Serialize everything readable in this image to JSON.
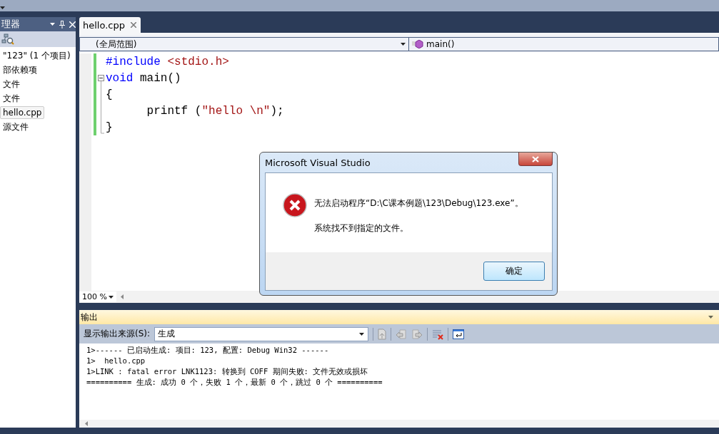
{
  "explorer": {
    "title": "理器",
    "tree": [
      {
        "label": "\"123\" (1 个项目)",
        "selected": false,
        "children": [
          {
            "label": "部依赖项",
            "selected": false
          },
          {
            "label": "文件",
            "selected": false
          },
          {
            "label": "文件",
            "selected": false,
            "children": [
              {
                "label": "hello.cpp",
                "selected": true
              }
            ]
          },
          {
            "label": "源文件",
            "selected": false
          }
        ]
      }
    ]
  },
  "editor": {
    "tabs": [
      {
        "label": "hello.cpp",
        "selected": true
      }
    ],
    "scope": "(全局范围)",
    "member": "main()",
    "lines": [
      {
        "changed": true,
        "kind": "plain",
        "tokens": [
          {
            "kind": "keyword",
            "text": "#include "
          },
          {
            "kind": "string",
            "text": "<stdio.h>"
          }
        ]
      },
      {
        "changed": true,
        "kind": "opener",
        "tokens": [
          {
            "kind": "keyword",
            "text": "void"
          },
          {
            "kind": "plain",
            "text": " main()"
          }
        ]
      },
      {
        "changed": true,
        "kind": "body",
        "tokens": [
          {
            "kind": "plain",
            "text": "{"
          }
        ]
      },
      {
        "changed": true,
        "kind": "body",
        "tokens": [
          {
            "kind": "plain",
            "text": "      printf ("
          },
          {
            "kind": "string",
            "text": "\"hello \\n\""
          },
          {
            "kind": "plain",
            "text": ");"
          }
        ]
      },
      {
        "changed": true,
        "kind": "closer",
        "tokens": [
          {
            "kind": "plain",
            "text": "}"
          }
        ]
      }
    ],
    "zoom": "100 %"
  },
  "output": {
    "title": "输出",
    "source_label": "显示输出来源(S):",
    "source": "生成",
    "lines": [
      "1>------ 已启动生成: 项目: 123, 配置: Debug Win32 ------",
      "1>  hello.cpp",
      "1>LINK : fatal error LNK1123: 转换到 COFF 期间失败: 文件无效或损坏",
      "========== 生成: 成功 0 个，失败 1 个，最新 0 个，跳过 0 个 =========="
    ]
  },
  "dialog": {
    "title": "Microsoft Visual Studio",
    "message": "无法启动程序“D:\\C课本例题\\123\\Debug\\123.exe”。",
    "detail": "系统找不到指定的文件。",
    "buttons": [
      "确定"
    ]
  }
}
